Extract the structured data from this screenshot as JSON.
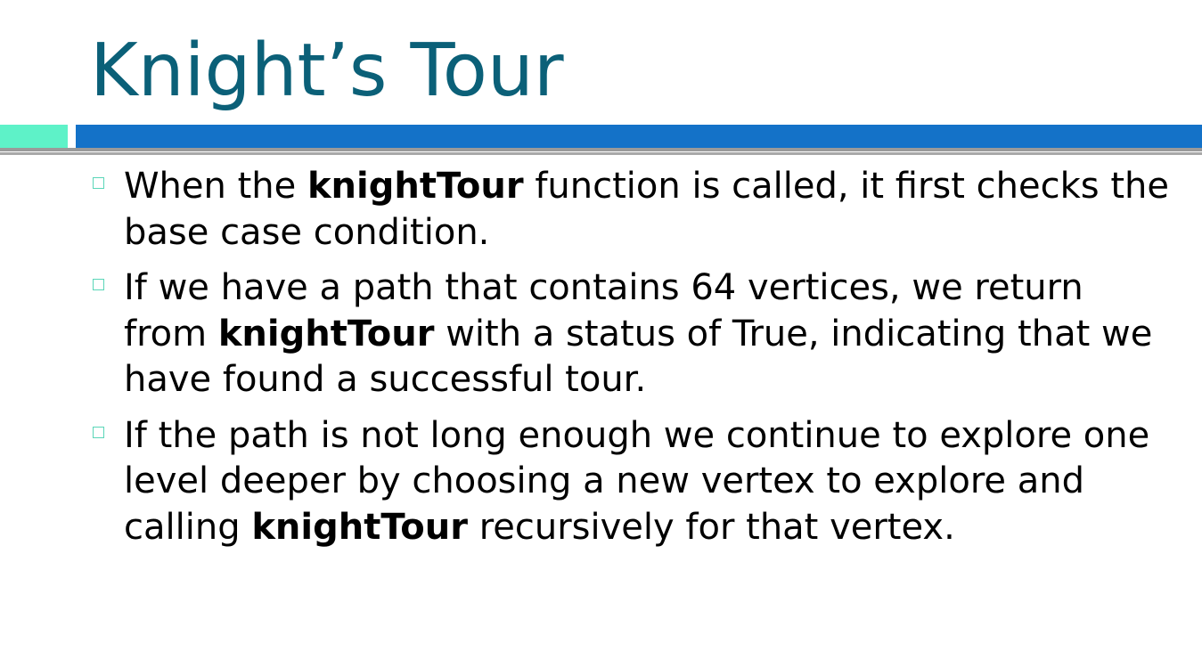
{
  "slide": {
    "title": "Knight’s Tour",
    "bullets": [
      {
        "parts": [
          "When the ",
          "knightTour",
          " function is called, it first checks the base case condition."
        ]
      },
      {
        "parts": [
          "If we have a path that contains 64 vertices, we return from ",
          "knightTour",
          " with a status of True, indicating that we have found a successful tour."
        ]
      },
      {
        "parts": [
          "If the path is not long enough we continue to explore one level deeper by choosing a new vertex to explore and calling ",
          "knightTour",
          " recursively for that vertex."
        ]
      }
    ]
  },
  "colors": {
    "title": "#0b6078",
    "accent_teal": "#5ef2c8",
    "accent_blue": "#1472c8",
    "rule_gray": "#9a9a9a",
    "bullet_marker": "#5ad6b8",
    "body_text": "#000000"
  },
  "icons": {
    "bullet_marker": "hollow-square-bullet-icon"
  }
}
